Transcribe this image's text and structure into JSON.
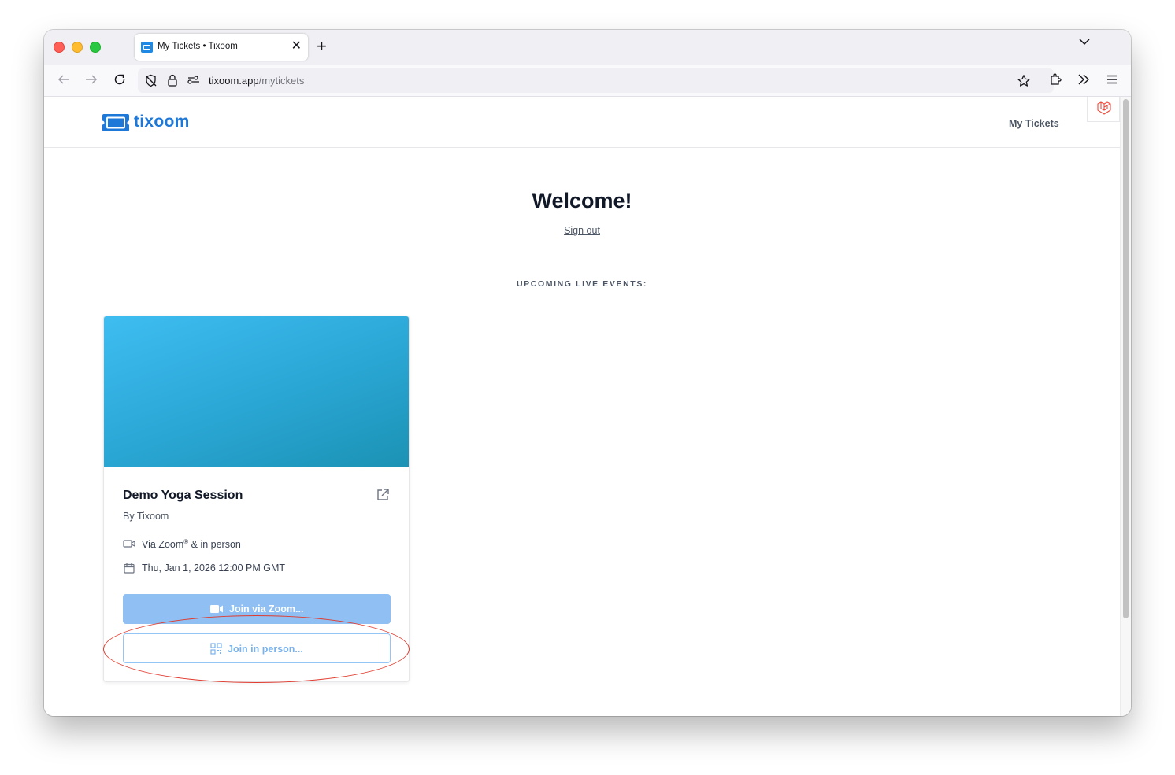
{
  "browser": {
    "tab_title": "My Tickets • Tixoom",
    "new_tab_glyph": "+",
    "close_glyph": "✕",
    "url_host": "tixoom.app",
    "url_path": "/mytickets"
  },
  "site": {
    "logo_text": "tixoom",
    "nav_my_tickets": "My Tickets"
  },
  "main": {
    "welcome": "Welcome!",
    "sign_out": "Sign out",
    "upcoming_heading": "UPCOMING LIVE EVENTS:"
  },
  "event": {
    "title": "Demo Yoga Session",
    "organizer": "By Tixoom",
    "venue_prefix": "Via Zoom",
    "venue_mark": "®",
    "venue_suffix": " & in person",
    "datetime": "Thu, Jan 1, 2026 12:00 PM GMT",
    "join_zoom_label": "Join via Zoom...",
    "join_person_label": "Join in person..."
  },
  "colors": {
    "brand_blue": "#1e78d8",
    "annotation_red": "#e03b2e",
    "hero_gradient_start": "#3ebdf1",
    "hero_gradient_end": "#1b92b4"
  }
}
